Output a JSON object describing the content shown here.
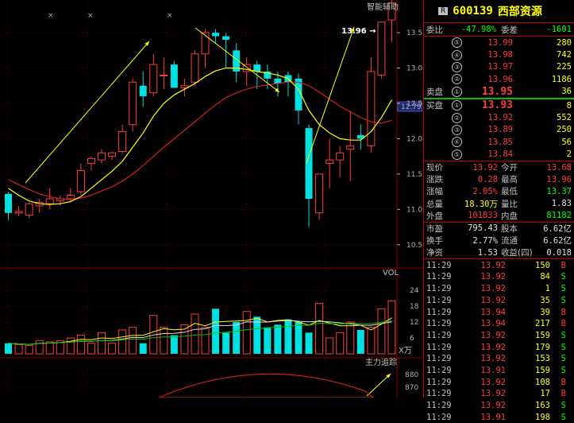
{
  "header": {
    "badge": "R",
    "code": "600139",
    "name": "西部资源"
  },
  "summary": {
    "weibi_label": "委比",
    "weibi_value": "-47.98%",
    "weicha_label": "委差",
    "weicha_value": "-1601"
  },
  "asks": [
    {
      "idx": "⑤",
      "price": "13.99",
      "vol": "280"
    },
    {
      "idx": "④",
      "price": "13.98",
      "vol": "742"
    },
    {
      "idx": "③",
      "price": "13.97",
      "vol": "225"
    },
    {
      "idx": "②",
      "price": "13.96",
      "vol": "1186"
    },
    {
      "idx": "①",
      "price": "13.95",
      "vol": "36"
    }
  ],
  "bids": [
    {
      "idx": "①",
      "price": "13.93",
      "vol": "8"
    },
    {
      "idx": "②",
      "price": "13.92",
      "vol": "552"
    },
    {
      "idx": "③",
      "price": "13.89",
      "vol": "250"
    },
    {
      "idx": "④",
      "price": "13.85",
      "vol": "56"
    },
    {
      "idx": "⑤",
      "price": "13.84",
      "vol": "2"
    }
  ],
  "ask_side_label": "卖盘",
  "bid_side_label": "买盘",
  "stats": [
    {
      "l1": "现价",
      "v1": "13.92",
      "c1": "red",
      "l2": "今开",
      "v2": "13.68",
      "c2": "red"
    },
    {
      "l1": "涨跌",
      "v1": "0.28",
      "c1": "red",
      "l2": "最高",
      "v2": "13.96",
      "c2": "red"
    },
    {
      "l1": "涨幅",
      "v1": "2.05%",
      "c1": "red",
      "l2": "最低",
      "v2": "13.37",
      "c2": "green"
    },
    {
      "l1": "总量",
      "v1": "18.30万",
      "c1": "yellow",
      "l2": "量比",
      "v2": "1.83",
      "c2": "white"
    },
    {
      "l1": "外盘",
      "v1": "101833",
      "c1": "red",
      "l2": "内盘",
      "v2": "81182",
      "c2": "green"
    }
  ],
  "stats2": [
    {
      "l1": "市盈",
      "v1": "795.43",
      "l2": "股本",
      "v2": "6.62亿"
    },
    {
      "l1": "换手",
      "v1": "2.77%",
      "l2": "流通",
      "v2": "6.62亿"
    },
    {
      "l1": "净资",
      "v1": "1.53",
      "l2": "收益(四)",
      "v2": "0.018"
    }
  ],
  "ticks": [
    {
      "time": "11:29",
      "price": "13.92",
      "vol": "150",
      "side": "B"
    },
    {
      "time": "11:29",
      "price": "13.92",
      "vol": "84",
      "side": "S"
    },
    {
      "time": "11:29",
      "price": "13.92",
      "vol": "1",
      "side": "S"
    },
    {
      "time": "11:29",
      "price": "13.92",
      "vol": "35",
      "side": "S"
    },
    {
      "time": "11:29",
      "price": "13.94",
      "vol": "39",
      "side": "B"
    },
    {
      "time": "11:29",
      "price": "13.94",
      "vol": "217",
      "side": "B"
    },
    {
      "time": "11:29",
      "price": "13.92",
      "vol": "159",
      "side": "S"
    },
    {
      "time": "11:29",
      "price": "13.92",
      "vol": "179",
      "side": "S"
    },
    {
      "time": "11:29",
      "price": "13.92",
      "vol": "153",
      "side": "S"
    },
    {
      "time": "11:29",
      "price": "13.91",
      "vol": "159",
      "side": "S"
    },
    {
      "time": "11:29",
      "price": "13.92",
      "vol": "108",
      "side": "B"
    },
    {
      "time": "11:29",
      "price": "13.92",
      "vol": "17",
      "side": "B"
    },
    {
      "time": "11:29",
      "price": "13.92",
      "vol": "163",
      "side": "S"
    },
    {
      "time": "11:29",
      "price": "13.91",
      "vol": "198",
      "side": "S"
    }
  ],
  "chart_labels": {
    "main_title": "智能辅助",
    "vol_title": "VOL",
    "vol_unit": "X万",
    "flow_title": "主力追踪",
    "current_price_tag": "12.79",
    "high_annotation": "13.96"
  },
  "colors": {
    "up": "#ff3c3c",
    "down": "#00e0e0",
    "ma_short": "#ffff00",
    "ma_long": "#d02020",
    "ma_vol_mid": "#00c000",
    "ma_vol_white": "#e0e0e0",
    "grid": "#8b0000"
  },
  "chart_data": {
    "type": "candlestick",
    "price_axis_ticks": [
      10.5,
      11.0,
      11.5,
      12.0,
      12.5,
      13.0,
      13.5
    ],
    "price_range": [
      10.25,
      13.85
    ],
    "candles": [
      {
        "o": 11.22,
        "h": 11.25,
        "l": 10.85,
        "c": 10.95
      },
      {
        "o": 10.95,
        "h": 11.05,
        "l": 10.9,
        "c": 10.97
      },
      {
        "o": 10.92,
        "h": 11.1,
        "l": 10.88,
        "c": 11.08
      },
      {
        "o": 11.05,
        "h": 11.15,
        "l": 10.95,
        "c": 11.1
      },
      {
        "o": 11.08,
        "h": 11.3,
        "l": 11.0,
        "c": 11.15
      },
      {
        "o": 11.12,
        "h": 11.2,
        "l": 11.05,
        "c": 11.15
      },
      {
        "o": 11.15,
        "h": 11.3,
        "l": 11.1,
        "c": 11.2
      },
      {
        "o": 11.25,
        "h": 11.65,
        "l": 11.2,
        "c": 11.55
      },
      {
        "o": 11.65,
        "h": 11.75,
        "l": 11.55,
        "c": 11.72
      },
      {
        "o": 11.7,
        "h": 11.85,
        "l": 11.65,
        "c": 11.8
      },
      {
        "o": 11.75,
        "h": 11.82,
        "l": 11.7,
        "c": 11.8
      },
      {
        "o": 11.82,
        "h": 12.2,
        "l": 11.8,
        "c": 12.1
      },
      {
        "o": 12.2,
        "h": 12.85,
        "l": 12.1,
        "c": 12.8
      },
      {
        "o": 12.75,
        "h": 12.95,
        "l": 12.45,
        "c": 12.6
      },
      {
        "o": 12.65,
        "h": 13.2,
        "l": 12.6,
        "c": 13.05
      },
      {
        "o": 12.9,
        "h": 13.15,
        "l": 12.7,
        "c": 12.9
      },
      {
        "o": 13.05,
        "h": 13.1,
        "l": 12.8,
        "c": 12.72
      },
      {
        "o": 12.72,
        "h": 12.85,
        "l": 12.6,
        "c": 12.75
      },
      {
        "o": 12.8,
        "h": 13.25,
        "l": 12.75,
        "c": 13.2
      },
      {
        "o": 13.2,
        "h": 13.55,
        "l": 13.0,
        "c": 13.5
      },
      {
        "o": 13.5,
        "h": 13.55,
        "l": 13.35,
        "c": 13.45
      },
      {
        "o": 13.45,
        "h": 13.5,
        "l": 13.0,
        "c": 13.4
      },
      {
        "o": 13.25,
        "h": 13.35,
        "l": 12.8,
        "c": 12.95
      },
      {
        "o": 12.95,
        "h": 13.15,
        "l": 12.75,
        "c": 13.05
      },
      {
        "o": 13.05,
        "h": 13.1,
        "l": 12.7,
        "c": 12.95
      },
      {
        "o": 12.95,
        "h": 13.05,
        "l": 12.7,
        "c": 12.85
      },
      {
        "o": 12.85,
        "h": 12.95,
        "l": 12.6,
        "c": 12.78
      },
      {
        "o": 12.9,
        "h": 12.95,
        "l": 12.6,
        "c": 12.8
      },
      {
        "o": 12.85,
        "h": 12.92,
        "l": 12.2,
        "c": 12.4
      },
      {
        "o": 12.15,
        "h": 12.2,
        "l": 10.75,
        "c": 11.15
      },
      {
        "o": 10.95,
        "h": 11.4,
        "l": 10.85,
        "c": 11.5
      },
      {
        "o": 11.65,
        "h": 12.0,
        "l": 11.3,
        "c": 11.7
      },
      {
        "o": 11.7,
        "h": 11.9,
        "l": 11.45,
        "c": 11.8
      },
      {
        "o": 11.85,
        "h": 12.4,
        "l": 11.4,
        "c": 11.9
      },
      {
        "o": 12.05,
        "h": 12.2,
        "l": 11.85,
        "c": 12.0
      },
      {
        "o": 11.9,
        "h": 13.15,
        "l": 11.8,
        "c": 12.95
      },
      {
        "o": 12.9,
        "h": 13.5,
        "l": 12.85,
        "c": 13.65
      },
      {
        "o": 13.68,
        "h": 13.96,
        "l": 13.37,
        "c": 13.92
      }
    ],
    "ma_short": [
      11.3,
      11.2,
      11.12,
      11.08,
      11.07,
      11.08,
      11.11,
      11.18,
      11.3,
      11.42,
      11.54,
      11.68,
      11.88,
      12.08,
      12.32,
      12.5,
      12.62,
      12.7,
      12.78,
      12.88,
      12.96,
      13.0,
      13.0,
      12.98,
      12.95,
      12.93,
      12.9,
      12.85,
      12.7,
      12.4,
      12.2,
      12.08,
      12.0,
      11.98,
      11.98,
      12.1,
      12.3,
      12.55
    ],
    "ma_long": [
      11.42,
      11.35,
      11.28,
      11.22,
      11.18,
      11.15,
      11.14,
      11.16,
      11.2,
      11.26,
      11.32,
      11.4,
      11.5,
      11.62,
      11.75,
      11.88,
      12.0,
      12.12,
      12.24,
      12.36,
      12.48,
      12.58,
      12.65,
      12.7,
      12.74,
      12.76,
      12.78,
      12.8,
      12.8,
      12.75,
      12.66,
      12.56,
      12.46,
      12.38,
      12.3,
      12.24,
      12.22,
      12.26
    ],
    "volume": {
      "axis_ticks": [
        6,
        12,
        18,
        24
      ],
      "range": [
        0,
        30
      ],
      "bars": [
        4,
        3.5,
        3.2,
        5,
        4.5,
        5,
        6,
        7,
        4,
        8,
        4,
        9,
        10,
        4,
        14.5,
        10,
        7,
        11,
        15,
        10,
        17,
        8,
        12,
        16,
        14,
        10,
        11,
        13,
        12,
        8,
        19,
        6,
        8,
        12,
        9,
        10,
        17,
        20
      ]
    },
    "flow": {
      "axis_ticks": [
        870,
        880
      ],
      "range": [
        862,
        888
      ]
    }
  }
}
